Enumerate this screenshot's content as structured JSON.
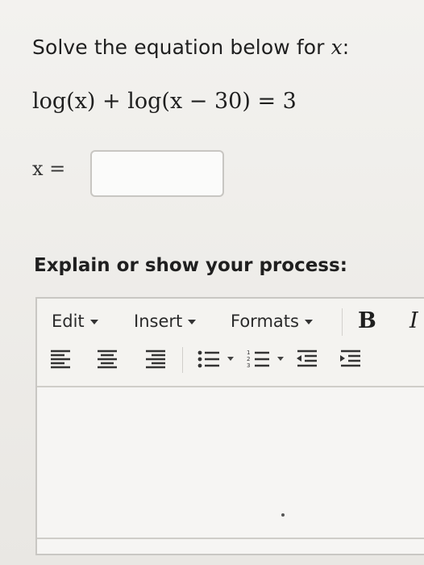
{
  "question": {
    "prompt_text": "Solve the equation below for ",
    "prompt_var": "x",
    "prompt_suffix": ":",
    "equation": "log(x) + log(x − 30) = 3",
    "answer_label": "x =",
    "answer_value": ""
  },
  "explain_label": "Explain or show your process:",
  "editor": {
    "menus": [
      "Edit",
      "Insert",
      "Formats"
    ],
    "bold_label": "B",
    "italic_label": "I",
    "toolbar_icons": [
      "align-left-icon",
      "align-center-icon",
      "align-right-icon",
      "bullet-list-icon",
      "numbered-list-icon",
      "outdent-icon",
      "indent-icon"
    ],
    "content": ""
  }
}
